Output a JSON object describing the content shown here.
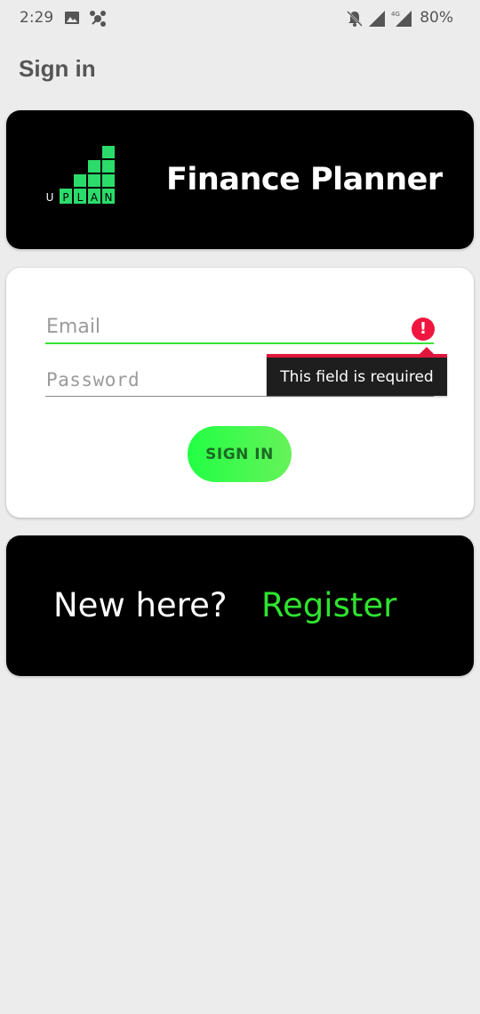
{
  "status_bar": {
    "time": "2:29",
    "network": "4G",
    "battery": "80%",
    "icons": [
      "image-icon",
      "app-notification-icon",
      "notifications-off-icon",
      "signal-icon",
      "signal-4g-icon"
    ]
  },
  "page": {
    "title": "Sign in"
  },
  "brand": {
    "logo_text": "UPLAN",
    "app_title": "Finance Planner",
    "logo_color": "#2bdc6a"
  },
  "form": {
    "email_placeholder": "Email",
    "password_placeholder": "Password",
    "error_message": "This field is required",
    "signin_label": "SIGN IN",
    "accent": "#33e533",
    "error_color": "#f0163f"
  },
  "register": {
    "prompt": "New here?",
    "link_label": "Register",
    "link_color": "#2fe32f"
  }
}
